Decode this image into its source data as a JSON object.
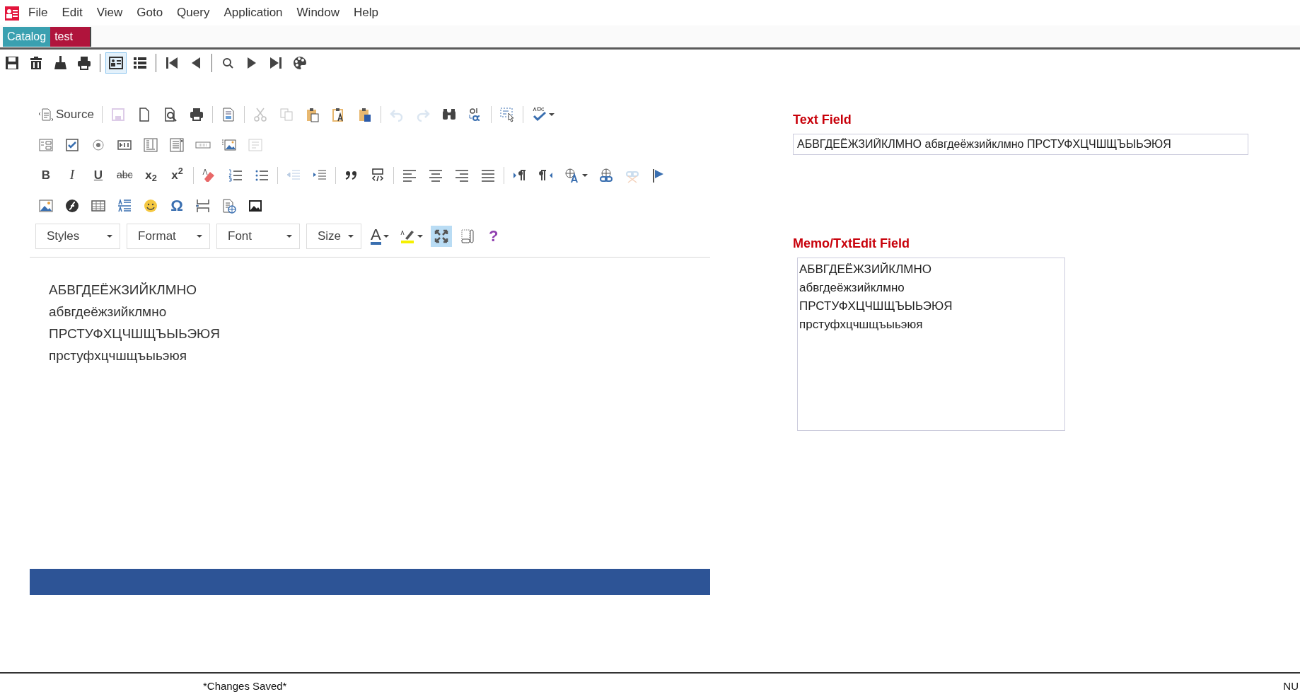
{
  "menu": {
    "items": [
      "File",
      "Edit",
      "View",
      "Goto",
      "Query",
      "Application",
      "Window",
      "Help"
    ]
  },
  "tabs": [
    {
      "label": "Catalog",
      "selected": false,
      "color": "#3aa0b0"
    },
    {
      "label": "test",
      "selected": true,
      "color": "#b0143c"
    }
  ],
  "app_toolbar": [
    {
      "kind": "save",
      "selected": false
    },
    {
      "kind": "delete",
      "selected": false
    },
    {
      "kind": "clear",
      "selected": false
    },
    {
      "kind": "print",
      "selected": false
    },
    {
      "kind": "separator"
    },
    {
      "kind": "form",
      "selected": true
    },
    {
      "kind": "list",
      "selected": false
    },
    {
      "kind": "separator"
    },
    {
      "kind": "first",
      "selected": false
    },
    {
      "kind": "prev",
      "selected": false
    },
    {
      "kind": "separator"
    },
    {
      "kind": "search",
      "selected": false
    },
    {
      "kind": "next",
      "selected": false
    },
    {
      "kind": "last",
      "selected": false
    },
    {
      "kind": "palette",
      "selected": false
    }
  ],
  "editor": {
    "toolbar_rows": [
      [
        {
          "kind": "source",
          "label": "Source",
          "disabled": false
        },
        {
          "kind": "separator"
        },
        {
          "kind": "save",
          "disabled": true
        },
        {
          "kind": "newpage",
          "disabled": false
        },
        {
          "kind": "preview",
          "disabled": false
        },
        {
          "kind": "print",
          "disabled": false
        },
        {
          "kind": "separator"
        },
        {
          "kind": "templates",
          "disabled": false
        },
        {
          "kind": "separator"
        },
        {
          "kind": "cut",
          "disabled": true
        },
        {
          "kind": "copy",
          "disabled": true
        },
        {
          "kind": "paste",
          "disabled": false
        },
        {
          "kind": "pastetext",
          "disabled": false
        },
        {
          "kind": "pasteword",
          "disabled": false
        },
        {
          "kind": "separator"
        },
        {
          "kind": "undo",
          "disabled": true
        },
        {
          "kind": "redo",
          "disabled": true
        },
        {
          "kind": "find",
          "disabled": false
        },
        {
          "kind": "replace",
          "disabled": false
        },
        {
          "kind": "separator"
        },
        {
          "kind": "selectall",
          "disabled": false
        },
        {
          "kind": "separator"
        },
        {
          "kind": "spellcheck",
          "disabled": false
        }
      ],
      [
        {
          "kind": "formfield",
          "disabled": false
        },
        {
          "kind": "checkbox",
          "disabled": false
        },
        {
          "kind": "radio",
          "disabled": false
        },
        {
          "kind": "textfield",
          "disabled": false
        },
        {
          "kind": "textarea",
          "disabled": false
        },
        {
          "kind": "select",
          "disabled": false
        },
        {
          "kind": "button",
          "disabled": false
        },
        {
          "kind": "imagebutton",
          "disabled": false
        },
        {
          "kind": "hiddenfield",
          "disabled": true
        }
      ],
      [
        {
          "kind": "bold",
          "label": "B",
          "disabled": false
        },
        {
          "kind": "italic",
          "label": "I",
          "disabled": false
        },
        {
          "kind": "underline",
          "label": "U",
          "disabled": false
        },
        {
          "kind": "strike",
          "label": "abc",
          "disabled": false
        },
        {
          "kind": "subscript",
          "label": "x$_{2}$",
          "disabled": false
        },
        {
          "kind": "superscript",
          "label": "x$^{2}$",
          "disabled": false
        },
        {
          "kind": "separator"
        },
        {
          "kind": "removeformat",
          "disabled": false
        },
        {
          "kind": "numberedlist",
          "disabled": false
        },
        {
          "kind": "bulletlist",
          "disabled": false
        },
        {
          "kind": "separator"
        },
        {
          "kind": "outdent",
          "disabled": true
        },
        {
          "kind": "indent",
          "disabled": false
        },
        {
          "kind": "separator"
        },
        {
          "kind": "blockquote",
          "disabled": false
        },
        {
          "kind": "creatediv",
          "disabled": false
        },
        {
          "kind": "separator"
        },
        {
          "kind": "alignleft",
          "disabled": false
        },
        {
          "kind": "aligncenter",
          "disabled": false
        },
        {
          "kind": "alignright",
          "disabled": false
        },
        {
          "kind": "justify",
          "disabled": false
        },
        {
          "kind": "separator"
        },
        {
          "kind": "ltr",
          "disabled": false
        },
        {
          "kind": "rtl",
          "disabled": false
        },
        {
          "kind": "language",
          "disabled": false
        },
        {
          "kind": "link",
          "disabled": false
        },
        {
          "kind": "unlink",
          "disabled": true
        },
        {
          "kind": "anchor",
          "disabled": false
        }
      ],
      [
        {
          "kind": "image",
          "disabled": false
        },
        {
          "kind": "flash",
          "disabled": false
        },
        {
          "kind": "table",
          "disabled": false
        },
        {
          "kind": "horizontalrule",
          "disabled": false
        },
        {
          "kind": "smiley",
          "disabled": false
        },
        {
          "kind": "specialchar",
          "label": "Ω",
          "disabled": false
        },
        {
          "kind": "pagebreak",
          "disabled": false
        },
        {
          "kind": "iframe",
          "disabled": false
        },
        {
          "kind": "picture",
          "disabled": false
        }
      ],
      [
        {
          "kind": "combo",
          "label": "Styles"
        },
        {
          "kind": "combo",
          "label": "Format"
        },
        {
          "kind": "combo",
          "label": "Font"
        },
        {
          "kind": "combo",
          "label": "Size"
        },
        {
          "kind": "textcolor",
          "label": "A",
          "disabled": false,
          "selected": false
        },
        {
          "kind": "bgcolor",
          "disabled": false,
          "selected": false
        },
        {
          "kind": "maximize",
          "disabled": false,
          "selected": true
        },
        {
          "kind": "showblocks",
          "disabled": false,
          "selected": false
        },
        {
          "kind": "about",
          "label": "?",
          "disabled": false,
          "selected": false
        }
      ]
    ],
    "content": [
      "АБВГДЕЁЖЗИЙКЛМНО",
      "абвгдеёжзийклмно",
      "ПРСТУФХЦЧШЩЪЫЬЭЮЯ",
      "прстуфхцчшщъыьэюя"
    ]
  },
  "text_field": {
    "label": "Text Field",
    "value": "АБВГДЕЁЖЗИЙКЛМНО абвгдеёжзийклмно ПРСТУФХЦЧШЩЪЫЬЭЮЯ"
  },
  "memo_field": {
    "label": "Memo/TxtEdit Field",
    "lines": [
      "АБВГДЕЁЖЗИЙКЛМНО",
      "абвгдеёжзийклмно",
      "ПРСТУФХЦЧШЩЪЫЬЭЮЯ",
      "прстуфхцчшщъыьэюя"
    ]
  },
  "status_bar": {
    "message": "*Changes Saved*",
    "indicator": "NU"
  }
}
